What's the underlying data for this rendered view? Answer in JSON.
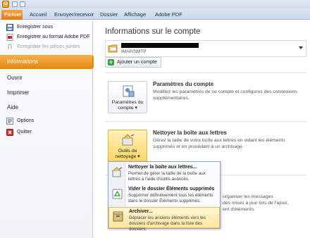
{
  "ribbon": {
    "tabs": [
      "Fichier",
      "Accueil",
      "Envoyer/recevoir",
      "Dossier",
      "Affichage",
      "Adobe PDF"
    ]
  },
  "leftnav": {
    "commands": [
      {
        "label": "Enregistrer sous",
        "icon": "save-icon",
        "enabled": true
      },
      {
        "label": "Enregistrer au format Adobe PDF",
        "icon": "pdf-icon",
        "enabled": true
      },
      {
        "label": "Enregistrer les pièces jointes",
        "icon": "attachment-icon",
        "enabled": false
      }
    ],
    "tabs": [
      "Informations",
      "Ouvrir",
      "Imprimer",
      "Aide"
    ],
    "active_tab": "Informations",
    "bottom": [
      {
        "label": "Options",
        "icon": "options-icon"
      },
      {
        "label": "Quitter",
        "icon": "exit-icon"
      }
    ]
  },
  "main": {
    "title": "Informations sur le compte",
    "account": {
      "type": "IMAP/SMTP"
    },
    "add_account_label": "Ajouter un compte",
    "account_settings": {
      "button_label": "Paramètres du compte ▾",
      "title": "Paramètres du compte",
      "description": "Modifiez les paramètres de ce compte et configurez des connexions supplémentaires."
    },
    "cleanup": {
      "button_label": "Outils de nettoyage ▾",
      "title": "Nettoyer la boîte aux lettres",
      "description": "Gérez la taille de votre boîte aux lettres en vidant les éléments supprimés et en procédant à un archivage."
    },
    "behind_text": [
      "organiser les messages",
      "des mises à jour lors de l'ajout,",
      "ent d'éléments."
    ],
    "menu": [
      {
        "title": "Nettoyer la boîte aux lettres...",
        "description": "Permet de gérer la taille de la boîte aux lettres à l'aide d'outils avancés.",
        "icon": "mailbox-cleanup-icon"
      },
      {
        "title": "Vider le dossier Éléments supprimés",
        "description": "Supprimer définitivement tous les éléments dans le dossier Éléments supprimés.",
        "icon": "recycle-icon"
      },
      {
        "title": "Archiver...",
        "description": "Déplacer les anciens éléments vers les dossiers d'archivage dans la liste des dossiers.",
        "icon": "archive-icon"
      }
    ],
    "highlighted_menu_index": 2
  },
  "colors": {
    "accent_orange": "#e7860f",
    "ribbon_blue": "#c9d8ea",
    "highlight_yellow": "#fde6a0"
  }
}
